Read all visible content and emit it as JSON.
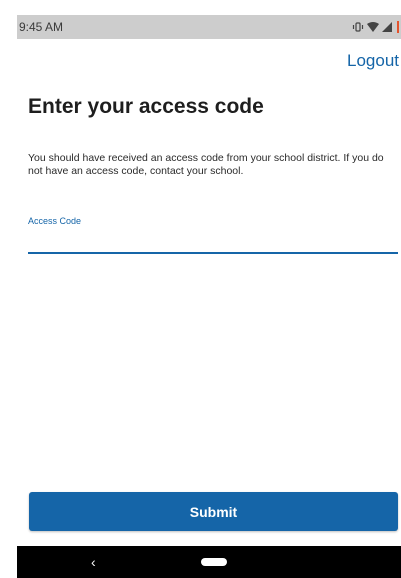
{
  "status_bar": {
    "time": "9:45 AM",
    "icons": [
      "vibrate-icon",
      "wifi-icon",
      "signal-icon",
      "battery-icon"
    ]
  },
  "header": {
    "logout_label": "Logout"
  },
  "main": {
    "title": "Enter your access code",
    "description": "You should have received an access code from your school district. If you do not have an access code, contact your school.",
    "access_code": {
      "label": "Access Code",
      "value": ""
    },
    "submit_label": "Submit"
  },
  "nav_bar": {
    "back_glyph": "‹"
  },
  "colors": {
    "accent": "#1565a8",
    "status_bar": "#cdcdcd",
    "nav_bar": "#000000",
    "battery": "#e4532d"
  }
}
